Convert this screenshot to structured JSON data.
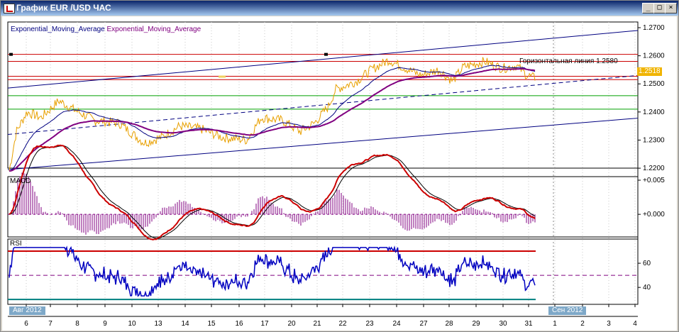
{
  "window": {
    "title": "График EUR /USD ЧАС",
    "buttons": [
      "_",
      "□",
      "×"
    ]
  },
  "price_panel": {
    "indicator_label_1": "Exponential_Moving_Average",
    "indicator_label_2": "Exponential_Moving_Average",
    "price_ticks": [
      "1.2700",
      "1.2600",
      "1.2500",
      "1.2400",
      "1.2300",
      "1.2200"
    ],
    "current_price": "1.2518",
    "horizontal_line_label": "Горизонтальная линия 1.2580"
  },
  "macd_panel": {
    "label": "MACD",
    "ticks": [
      "+0.005",
      "+0.000"
    ]
  },
  "rsi_panel": {
    "label": "RSI",
    "ticks": [
      "60",
      "40"
    ]
  },
  "time_axis": {
    "labels": [
      "6",
      "7",
      "8",
      "9",
      "10",
      "13",
      "14",
      "15",
      "16",
      "17",
      "20",
      "21",
      "22",
      "23",
      "24",
      "27",
      "28",
      "29",
      "30",
      "31",
      "1",
      "2",
      "3",
      "4"
    ],
    "month_badge_1": "Авг 2012",
    "month_badge_2": "Сен 2012"
  },
  "colors": {
    "price_line": "#e8a000",
    "ema_fast": "#000080",
    "ema_slow": "#800080",
    "macd_line": "#cc0000",
    "signal_line": "#000000",
    "histogram": "#800080",
    "rsi_line": "#0000c0",
    "rsi_overbought": "#cc0000",
    "rsi_oversold": "#008080",
    "hline_red": "#cc0000",
    "hline_green": "#00a000",
    "channel": "#000080"
  }
}
